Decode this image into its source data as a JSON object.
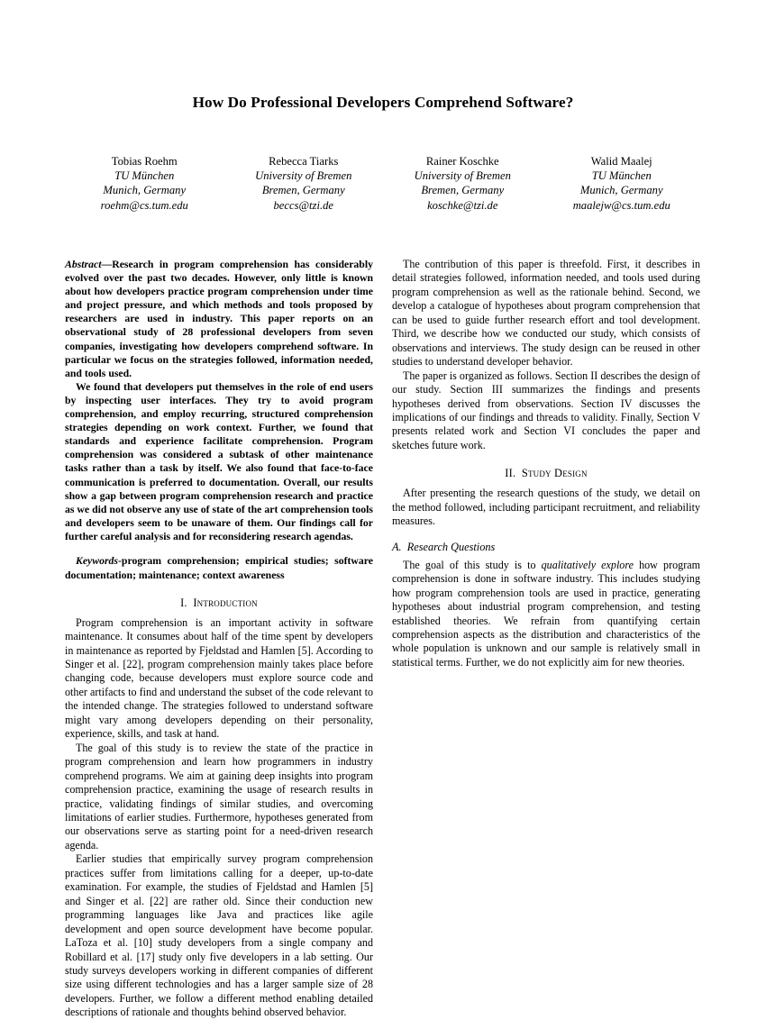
{
  "paper": {
    "title": "How Do Professional Developers Comprehend Software?",
    "authors": [
      {
        "name": "Tobias Roehm",
        "affiliation": "TU München",
        "location": "Munich, Germany",
        "email": "roehm@cs.tum.edu"
      },
      {
        "name": "Rebecca Tiarks",
        "affiliation": "University of Bremen",
        "location": "Bremen, Germany",
        "email": "beccs@tzi.de"
      },
      {
        "name": "Rainer Koschke",
        "affiliation": "University of Bremen",
        "location": "Bremen, Germany",
        "email": "koschke@tzi.de"
      },
      {
        "name": "Walid Maalej",
        "affiliation": "TU München",
        "location": "Munich, Germany",
        "email": "maalejw@cs.tum.edu"
      }
    ],
    "abstract": {
      "lead": "Abstract",
      "dash": "—",
      "paragraph_1": "Research in program comprehension has considerably evolved over the past two decades. However, only little is known about how developers practice program comprehension under time and project pressure, and which methods and tools proposed by researchers are used in industry. This paper reports on an observational study of 28 professional developers from seven companies, investigating how developers comprehend software. In particular we focus on the strategies followed, information needed, and tools used.",
      "paragraph_2": "We found that developers put themselves in the role of end users by inspecting user interfaces. They try to avoid program comprehension, and employ recurring, structured comprehension strategies depending on work context. Further, we found that standards and experience facilitate comprehension. Program comprehension was considered a subtask of other maintenance tasks rather than a task by itself. We also found that face-to-face communication is preferred to documentation. Overall, our results show a gap between program comprehension research and practice as we did not observe any use of state of the art comprehension tools and developers seem to be unaware of them. Our findings call for further careful analysis and for reconsidering research agendas."
    },
    "keywords": {
      "lead": "Keywords",
      "separator": "-",
      "text": "program comprehension; empirical studies; software documentation; maintenance; context awareness"
    },
    "sections": [
      {
        "numeral": "I.",
        "title": "Introduction",
        "paragraphs": [
          "Program comprehension is an important activity in software maintenance. It consumes about half of the time spent by developers in maintenance as reported by Fjeldstad and Hamlen [5]. According to Singer et al. [22], program comprehension mainly takes place before changing code, because developers must explore source code and other artifacts to find and understand the subset of the code relevant to the intended change. The strategies followed to understand software might vary among developers depending on their personality, experience, skills, and task at hand.",
          "The goal of this study is to review the state of the practice in program comprehension and learn how programmers in industry comprehend programs. We aim at gaining deep insights into program comprehension practice, examining the usage of research results in practice, validating findings of similar studies, and overcoming limitations of earlier studies. Furthermore, hypotheses generated from our observations serve as starting point for a need-driven research agenda.",
          "Earlier studies that empirically survey program comprehension practices suffer from limitations calling for a deeper, up-to-date examination. For example, the studies of Fjeldstad and Hamlen [5] and Singer et al. [22] are rather old. Since their conduction new programming languages like Java and practices like agile development and open source development have become popular. LaToza et al. [10] study developers from a single company and Robillard et al. [17] study only five developers in a lab setting. Our study surveys developers working in different companies of different size using different technologies and has a larger sample size of 28 developers. Further, we follow a different method enabling detailed descriptions of rationale and thoughts behind observed behavior.",
          "The contribution of this paper is threefold. First, it describes in detail strategies followed, information needed, and tools used during program comprehension as well as the rationale behind. Second, we develop a catalogue of hypotheses about program comprehension that can be used to guide further research effort and tool development. Third, we describe how we conducted our study, which consists of observations and interviews. The study design can be reused in other studies to understand developer behavior.",
          "The paper is organized as follows. Section II describes the design of our study. Section III summarizes the findings and presents hypotheses derived from observations. Section IV discusses the implications of our findings and threads to validity. Finally, Section V presents related work and Section VI concludes the paper and sketches future work."
        ]
      },
      {
        "numeral": "II.",
        "title": "Study Design",
        "intro_paragraph": "After presenting the research questions of the study, we detail on the method followed, including participant recruitment, and reliability measures.",
        "subsection": {
          "label": "A.",
          "title": "Research Questions",
          "paragraph_part_1": "The goal of this study is to ",
          "paragraph_italic": "qualitatively explore",
          "paragraph_part_2": " how program comprehension is done in software industry. This includes studying how program comprehension tools are used in practice, generating hypotheses about industrial program comprehension, and testing established theories. We refrain from quantifying certain comprehension aspects as the distribution and characteristics of the whole population is unknown and our sample is relatively small in statistical terms. Further, we do not explicitly aim for new theories."
        }
      }
    ]
  }
}
